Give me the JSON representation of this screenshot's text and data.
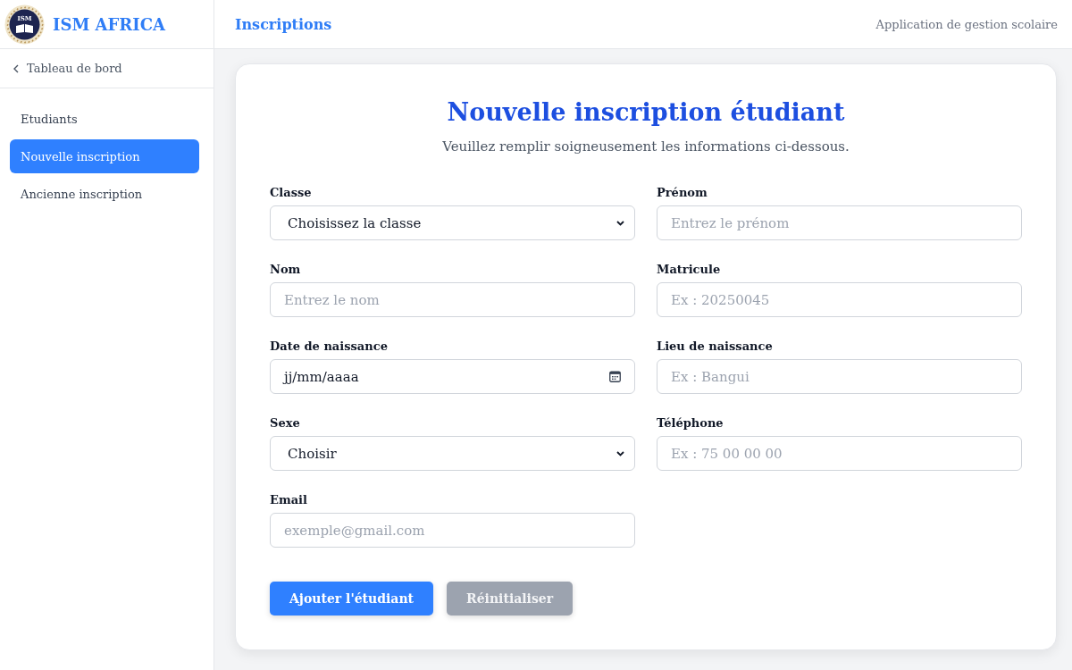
{
  "brand": {
    "logo_text": "ISM",
    "name": "ISM AFRICA"
  },
  "header": {
    "title": "Inscriptions",
    "subtitle": "Application de gestion scolaire"
  },
  "sidebar": {
    "back_link": "Tableau de bord",
    "items": [
      {
        "label": "Etudiants",
        "selected": false
      },
      {
        "label": "Nouvelle inscription",
        "selected": true
      },
      {
        "label": "Ancienne inscription",
        "selected": false
      }
    ]
  },
  "form": {
    "title": "Nouvelle inscription étudiant",
    "subtitle": "Veuillez remplir soigneusement les informations ci-dessous.",
    "fields": [
      {
        "label": "Classe",
        "kind": "select",
        "value": "Choisissez la classe"
      },
      {
        "label": "Prénom",
        "kind": "text",
        "placeholder": "Entrez le prénom"
      },
      {
        "label": "Nom",
        "kind": "text",
        "placeholder": "Entrez le nom"
      },
      {
        "label": "Matricule",
        "kind": "text",
        "placeholder": "Ex : 20250045"
      },
      {
        "label": "Date de naissance",
        "kind": "date",
        "value": "jj/mm/aaaa"
      },
      {
        "label": "Lieu de naissance",
        "kind": "text",
        "placeholder": "Ex : Bangui"
      },
      {
        "label": "Sexe",
        "kind": "select",
        "value": "Choisir"
      },
      {
        "label": "Téléphone",
        "kind": "text",
        "placeholder": "Ex : 75 00 00 00"
      },
      {
        "label": "Email",
        "kind": "text",
        "placeholder": "exemple@gmail.com"
      }
    ],
    "buttons": [
      {
        "label": "Ajouter l'étudiant",
        "kind": "primary"
      },
      {
        "label": "Réinitialiser",
        "kind": "secondary"
      }
    ]
  }
}
